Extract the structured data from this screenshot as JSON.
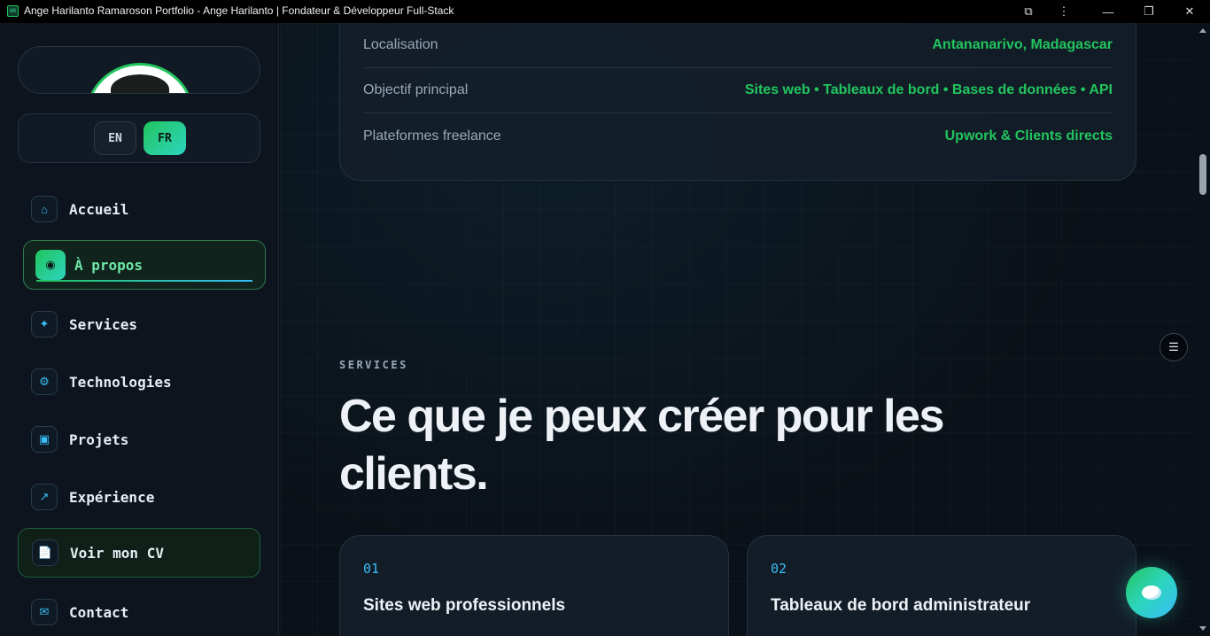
{
  "window": {
    "favicon_text": "AR",
    "title": "Ange Harilanto Ramaroson Portfolio - Ange Harilanto | Fondateur & Développeur Full-Stack",
    "extensions_icon": "⧉",
    "menu_icon": "⋮",
    "minimize_icon": "—",
    "maximize_icon": "❐",
    "close_icon": "✕"
  },
  "sidebar": {
    "languages": {
      "en": "EN",
      "fr": "FR",
      "active": "FR"
    },
    "nav": [
      {
        "label": "Accueil",
        "icon": "⌂"
      },
      {
        "label": "À propos",
        "icon": "◉"
      },
      {
        "label": "Services",
        "icon": "✦"
      },
      {
        "label": "Technologies",
        "icon": "⚙"
      },
      {
        "label": "Projets",
        "icon": "▣"
      },
      {
        "label": "Expérience",
        "icon": "↗"
      },
      {
        "label": "Voir mon CV",
        "icon": "📄"
      },
      {
        "label": "Contact",
        "icon": "✉"
      }
    ]
  },
  "info": {
    "rows": [
      {
        "key": "Localisation",
        "value": "Antananarivo, Madagascar"
      },
      {
        "key": "Objectif principal",
        "value": "Sites web • Tableaux de bord • Bases de données • API"
      },
      {
        "key": "Plateformes freelance",
        "value": "Upwork & Clients directs"
      }
    ]
  },
  "services": {
    "eyebrow": "SERVICES",
    "heading_line1": "Ce que je peux créer pour les",
    "heading_line2": "clients.",
    "cards": [
      {
        "num": "01",
        "title": "Sites web professionnels"
      },
      {
        "num": "02",
        "title": "Tableaux de bord administrateur"
      }
    ]
  },
  "floating": {
    "toc_icon": "☰"
  },
  "colors": {
    "accent_green": "#22c55e",
    "accent_teal": "#2dd4bf",
    "accent_blue": "#38bdf8",
    "bg": "#0b1118"
  }
}
